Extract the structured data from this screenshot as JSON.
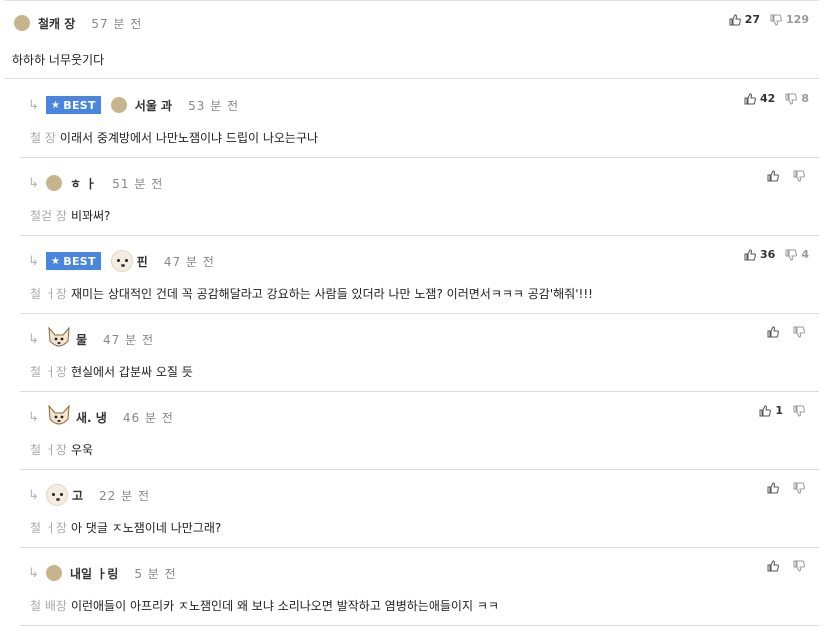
{
  "parent": {
    "nick": "철캐    장",
    "time": "57 분 전",
    "up": "27",
    "down": "129",
    "text": "하하하 너무웃기다"
  },
  "replies": [
    {
      "best": true,
      "best_label": "BEST",
      "nick": "서울      과",
      "time": "53 분 전",
      "up": "42",
      "down": "8",
      "author": "철        장",
      "text": "이래서 중계방에서 나만노잼이냐 드립이 나오는구나",
      "avatar": "circle"
    },
    {
      "best": false,
      "nick": "ㅎ  ㅏ",
      "time": "51 분 전",
      "up": "",
      "down": "",
      "author": "철걷    장",
      "text": "비꽈써?",
      "avatar": "circle"
    },
    {
      "best": true,
      "best_label": "BEST",
      "nick": "핀",
      "time": "47 분 전",
      "up": "36",
      "down": "4",
      "author": "철      ㅓ장",
      "text": "재미는 상대적인 건데 꼭 공감해달라고 강요하는 사람들 있더라 나만 노잼? 이러면서ㅋㅋㅋ 공감'해줘'!!!",
      "avatar": "dog"
    },
    {
      "best": false,
      "nick": "물",
      "time": "47 분 전",
      "up": "",
      "down": "",
      "author": "철       ㅓ장",
      "text": "현실에서 갑분싸 오질 듯",
      "avatar": "fox"
    },
    {
      "best": false,
      "nick": "새.        냉",
      "time": "46 분 전",
      "up": "1",
      "down": "",
      "author": "철       ㅓ장",
      "text": "우욱",
      "avatar": "fox"
    },
    {
      "best": false,
      "nick": "고",
      "time": "22 분 전",
      "up": "",
      "down": "",
      "author": "철        ㅓ장",
      "text": "아 댓글 ㅈ노잼이네 나만그래?",
      "avatar": "dog"
    },
    {
      "best": false,
      "nick": "내일       ㅏ링",
      "time": "5 분 전",
      "up": "",
      "down": "",
      "author": "철       배장",
      "text": "이런애들이 아프리카 ㅈ노잼인데 왜 보냐 소리나오면 발작하고 염병하는애들이지 ㅋㅋ",
      "avatar": "circle"
    }
  ],
  "icons": {
    "reply_arrow": "reply-arrow-icon",
    "thumbs_up": "thumbs-up-icon",
    "thumbs_down": "thumbs-down-icon",
    "star": "star-icon"
  },
  "colors": {
    "best_badge": "#4a86e0",
    "avatar": "#c8b48c",
    "divider": "#dcdcdc"
  }
}
